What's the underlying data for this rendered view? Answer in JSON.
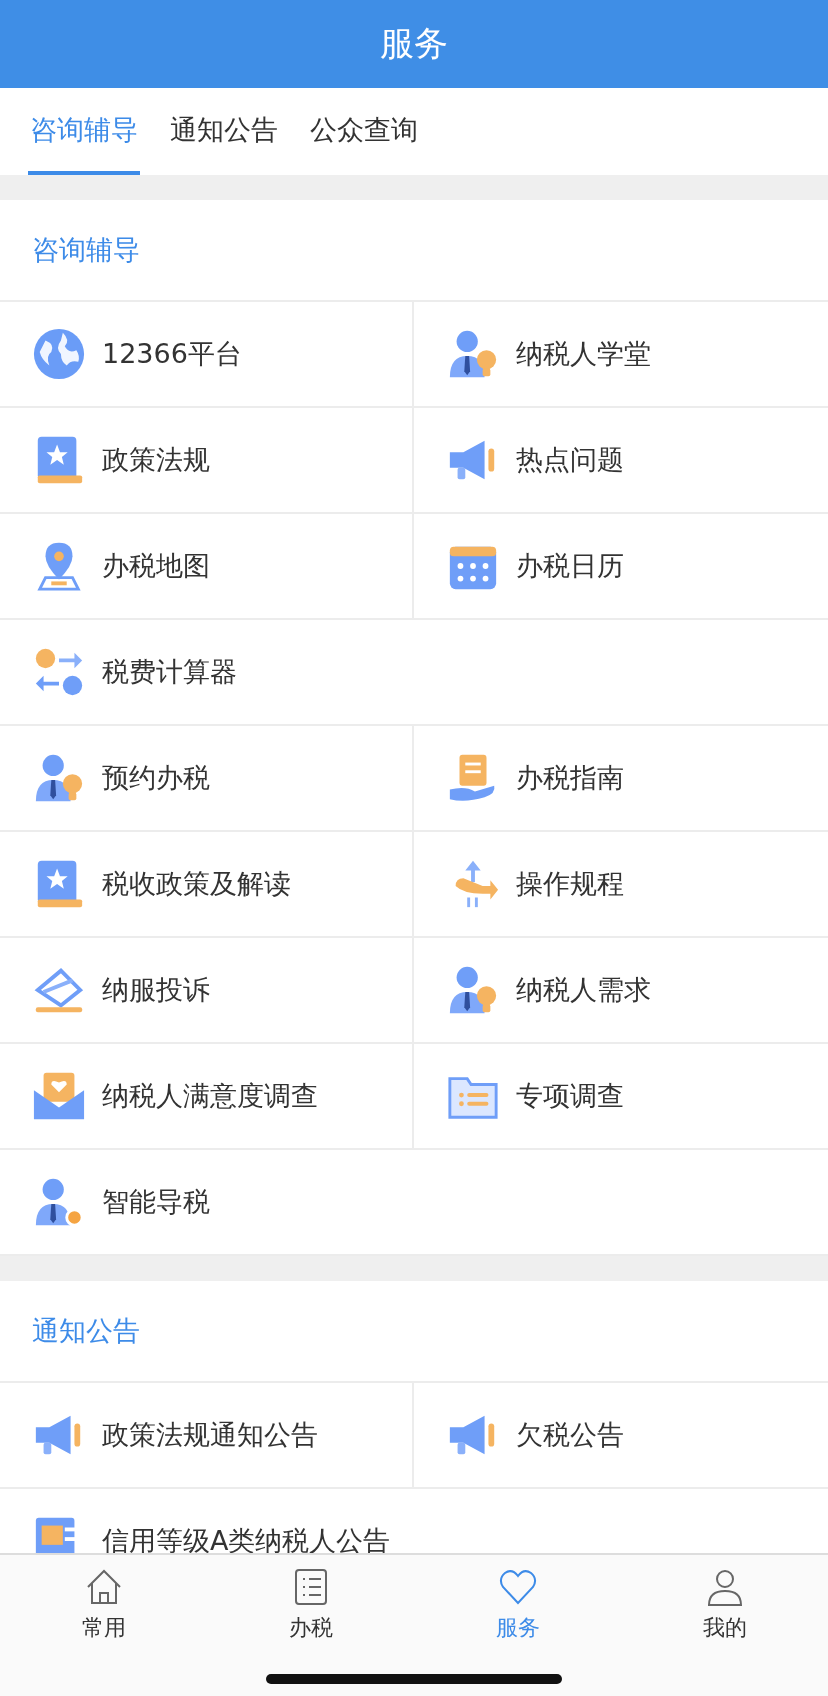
{
  "header": {
    "title": "服务"
  },
  "tabs": [
    {
      "label": "咨询辅导",
      "selected": true
    },
    {
      "label": "通知公告",
      "selected": false
    },
    {
      "label": "公众查询",
      "selected": false
    }
  ],
  "sections": [
    {
      "title": "咨询辅导",
      "rows": [
        {
          "items": [
            "12366平台",
            "纳税人学堂"
          ]
        },
        {
          "items": [
            "政策法规",
            "热点问题"
          ]
        },
        {
          "items": [
            "办税地图",
            "办税日历"
          ]
        },
        {
          "items": [
            "税费计算器"
          ]
        },
        {
          "items": [
            "预约办税",
            "办税指南"
          ]
        },
        {
          "items": [
            "税收政策及解读",
            "操作规程"
          ]
        },
        {
          "items": [
            "纳服投诉",
            "纳税人需求"
          ]
        },
        {
          "items": [
            "纳税人满意度调查",
            "专项调查"
          ]
        },
        {
          "items": [
            "智能导税"
          ]
        }
      ]
    },
    {
      "title": "通知公告",
      "rows": [
        {
          "items": [
            "政策法规通知公告",
            "欠税公告"
          ]
        },
        {
          "items": [
            "信用等级A类纳税人公告"
          ]
        }
      ]
    }
  ],
  "nav": [
    {
      "label": "常用",
      "selected": false
    },
    {
      "label": "办税",
      "selected": false
    },
    {
      "label": "服务",
      "selected": true
    },
    {
      "label": "我的",
      "selected": false
    }
  ]
}
